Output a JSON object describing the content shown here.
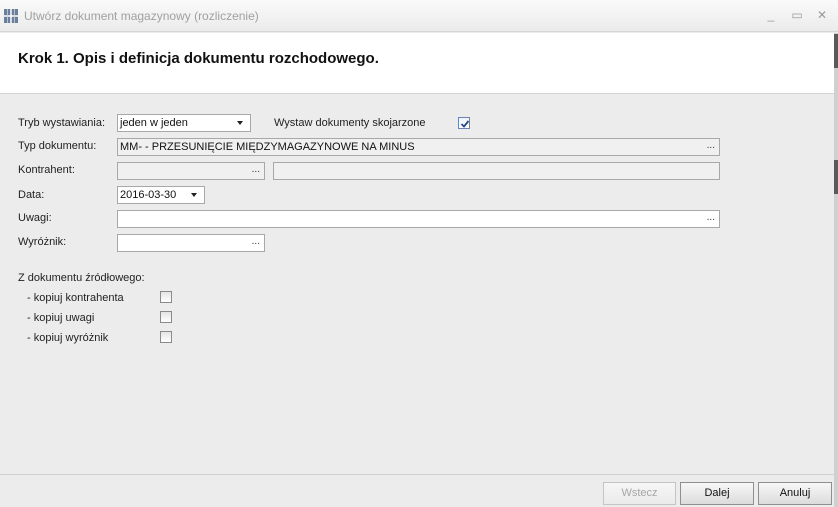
{
  "window": {
    "title": "Utwórz dokument magazynowy (rozliczenie)",
    "minimize_glyph": "_",
    "maximize_glyph": "▭",
    "close_glyph": "✕",
    "app_icon": "grid-app-icon"
  },
  "header": {
    "step_title": "Krok 1.  Opis i definicja dokumentu rozchodowego."
  },
  "form": {
    "tryb": {
      "label": "Tryb wystawiania:",
      "value": "jeden w jeden"
    },
    "skojarzone": {
      "label": "Wystaw dokumenty skojarzone",
      "checked": true
    },
    "typ": {
      "label": "Typ dokumentu:",
      "value": "MM- - PRZESUNIĘCIE MIĘDZYMAGAZYNOWE NA MINUS",
      "button": "..."
    },
    "kontrahent": {
      "label": "Kontrahent:",
      "code": "",
      "name": "",
      "button": "..."
    },
    "data": {
      "label": "Data:",
      "value": "2016-03-30"
    },
    "uwagi": {
      "label": "Uwagi:",
      "value": "",
      "button": "..."
    },
    "wyroznik": {
      "label": "Wyróżnik:",
      "value": "",
      "button": "..."
    }
  },
  "source": {
    "heading": "Z dokumentu źródłowego:",
    "options": [
      {
        "label": "- kopiuj kontrahenta",
        "checked": false
      },
      {
        "label": "- kopiuj uwagi",
        "checked": false
      },
      {
        "label": "- kopiuj wyróżnik",
        "checked": false
      }
    ]
  },
  "footer": {
    "back_label": "Wstecz",
    "next_label": "Dalej",
    "cancel_label": "Anuluj"
  },
  "colors": {
    "checkmark": "#2a4a8a",
    "accent_mark": "#5a5a5a"
  }
}
